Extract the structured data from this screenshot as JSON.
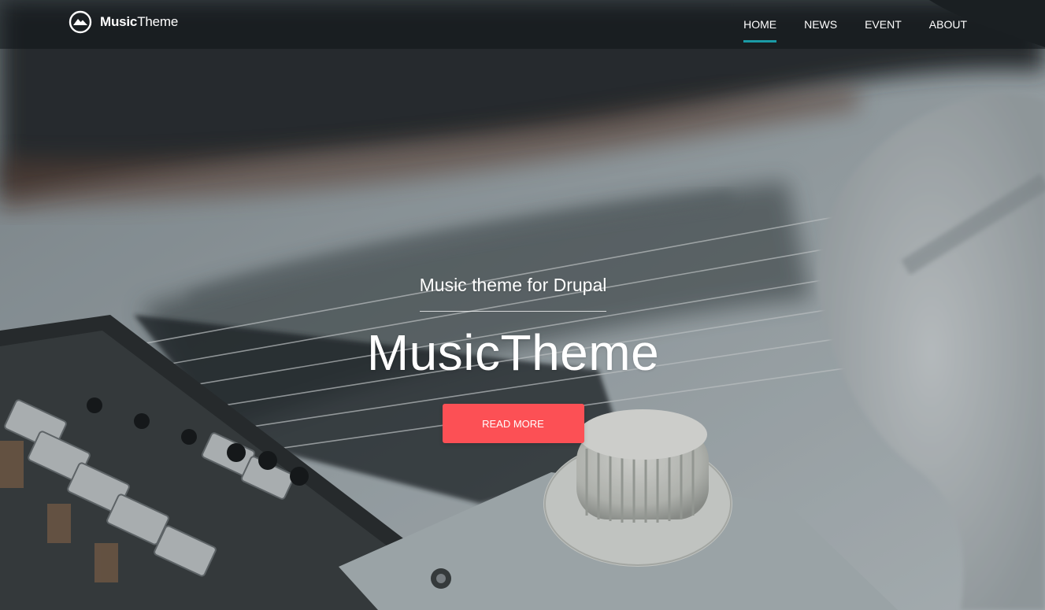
{
  "logo": {
    "icon": "mountain-circle-icon",
    "bold_text": "Music",
    "light_text": "Theme"
  },
  "nav": {
    "items": [
      {
        "label": "HOME",
        "active": true
      },
      {
        "label": "NEWS",
        "active": false
      },
      {
        "label": "EVENT",
        "active": false
      },
      {
        "label": "ABOUT",
        "active": false
      }
    ],
    "active_color": "#1a9ba6"
  },
  "hero": {
    "subtitle": "Music theme for Drupal",
    "title": "MusicTheme",
    "button_label": "READ MORE",
    "button_color": "#fc5055",
    "background": "electric-guitar-photo"
  }
}
